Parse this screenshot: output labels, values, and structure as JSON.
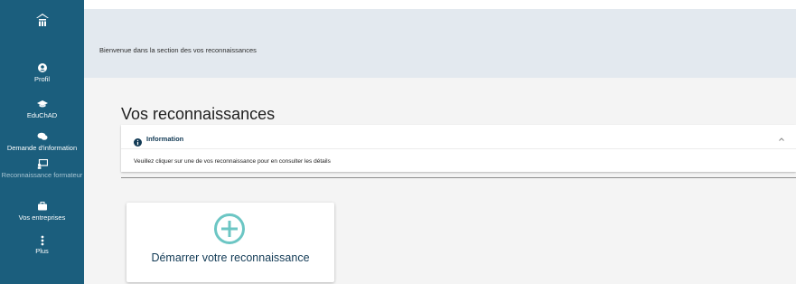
{
  "sidebar": {
    "items": [
      {
        "label": "Profil",
        "icon": "user-icon"
      },
      {
        "label": "EduChAD",
        "icon": "graduation-cap-icon"
      },
      {
        "label": "Demande d'information",
        "icon": "chat-icon"
      },
      {
        "label": "Reconnaissance formateur",
        "icon": "teacher-board-icon",
        "active": true
      },
      {
        "label": "Vos entreprises",
        "icon": "briefcase-icon"
      },
      {
        "label": "Plus",
        "icon": "more-vertical-icon"
      }
    ]
  },
  "header": {
    "welcome": "Bienvenue dans la section des vos reconnaissances"
  },
  "main": {
    "title": "Vos reconnaissances",
    "info": {
      "heading": "Information",
      "body": "Veuillez cliquer sur une de vos reconnaissance pour en consulter les détails"
    },
    "start_card": {
      "label": "Démarrer votre reconnaissance"
    }
  },
  "colors": {
    "sidebar": "#1b5e7d",
    "header_band": "#e3e9ef",
    "accent_plus": "#6cc6c4",
    "title_text": "#123a55"
  }
}
